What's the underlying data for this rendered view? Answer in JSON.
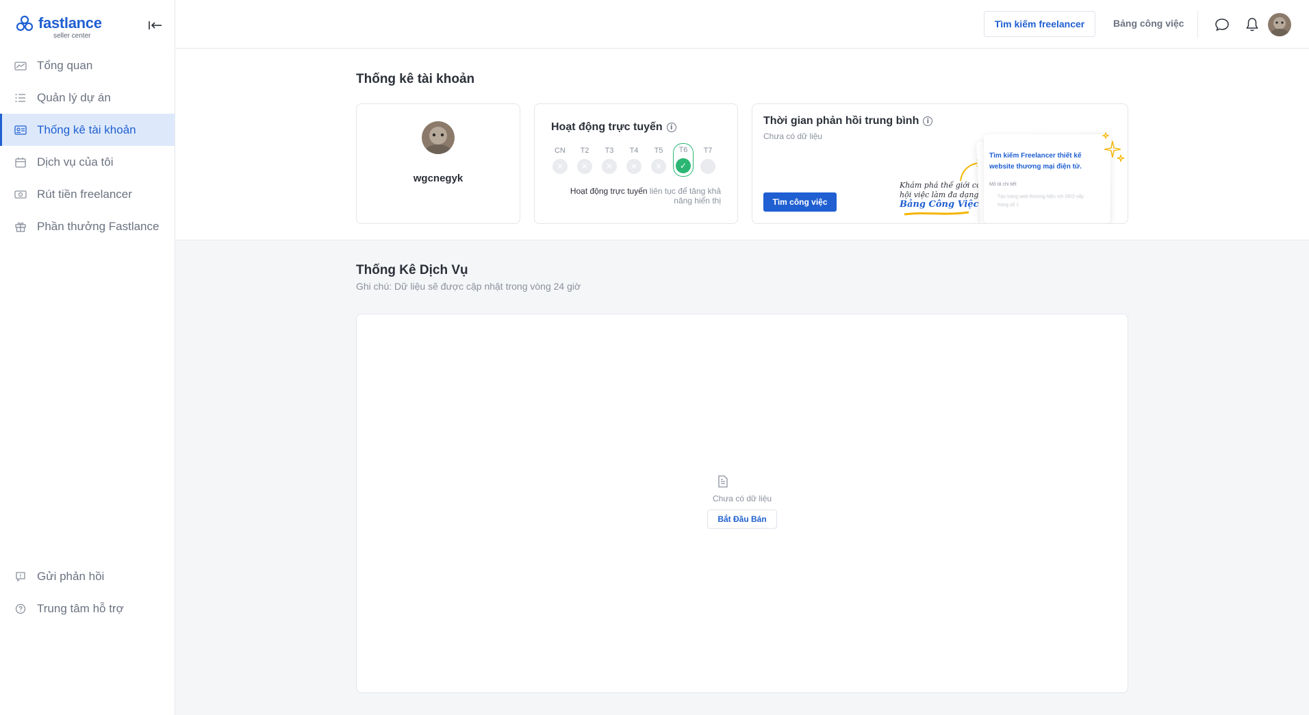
{
  "brand": {
    "name": "fastlance",
    "subtitle": "seller center",
    "accent": "#1f5fd1"
  },
  "sidebar": {
    "items": [
      {
        "label": "Tổng quan",
        "icon": "chart-icon",
        "active": false
      },
      {
        "label": "Quản lý dự án",
        "icon": "checklist-icon",
        "active": false
      },
      {
        "label": "Thống kê tài khoản",
        "icon": "id-card-icon",
        "active": true
      },
      {
        "label": "Dịch vụ của tôi",
        "icon": "calendar-icon",
        "active": false
      },
      {
        "label": "Rút tiền freelancer",
        "icon": "cash-icon",
        "active": false
      },
      {
        "label": "Phần thưởng Fastlance",
        "icon": "gift-icon",
        "active": false
      }
    ],
    "bottom_items": [
      {
        "label": "Gửi phản hồi",
        "icon": "feedback-icon"
      },
      {
        "label": "Trung tâm hỗ trợ",
        "icon": "help-icon"
      }
    ]
  },
  "header": {
    "find_freelancer": "Tìm kiếm freelancer",
    "job_board": "Bảng công việc"
  },
  "account_stats": {
    "title": "Thống kê tài khoản",
    "profile": {
      "username": "wgcnegyk"
    },
    "online": {
      "title": "Hoạt động trực tuyến",
      "days": [
        {
          "label": "CN",
          "active": false
        },
        {
          "label": "T2",
          "active": false
        },
        {
          "label": "T3",
          "active": false
        },
        {
          "label": "T4",
          "active": false
        },
        {
          "label": "T5",
          "active": false
        },
        {
          "label": "T6",
          "active": true
        },
        {
          "label": "T7",
          "active": false
        }
      ],
      "note_strong": "Hoạt động trực tuyến",
      "note_rest": " liên tục để tăng khả năng hiển thị"
    },
    "response": {
      "title": "Thời gian phản hồi trung bình",
      "empty": "Chưa có dữ liệu",
      "button": "Tìm công việc",
      "promo_line1": "Khám phá thế giới cơ",
      "promo_line2": "hội việc làm đa dạng với",
      "promo_highlight": "Bảng Công Việc",
      "card_title": "Tìm kiếm Freelancer thiết kế website thương mại điện tử.",
      "card_label": "Mô tả chi tiết",
      "card_blur": "Tạo trang web thương hiệu với SEO vấy trang số 1"
    }
  },
  "service_stats": {
    "title": "Thống Kê Dịch Vụ",
    "note": "Ghi chú: Dữ liệu sẽ được cập nhật trong vòng 24 giờ",
    "empty": "Chưa có dữ liệu",
    "start_button": "Bắt Đầu Bán"
  }
}
